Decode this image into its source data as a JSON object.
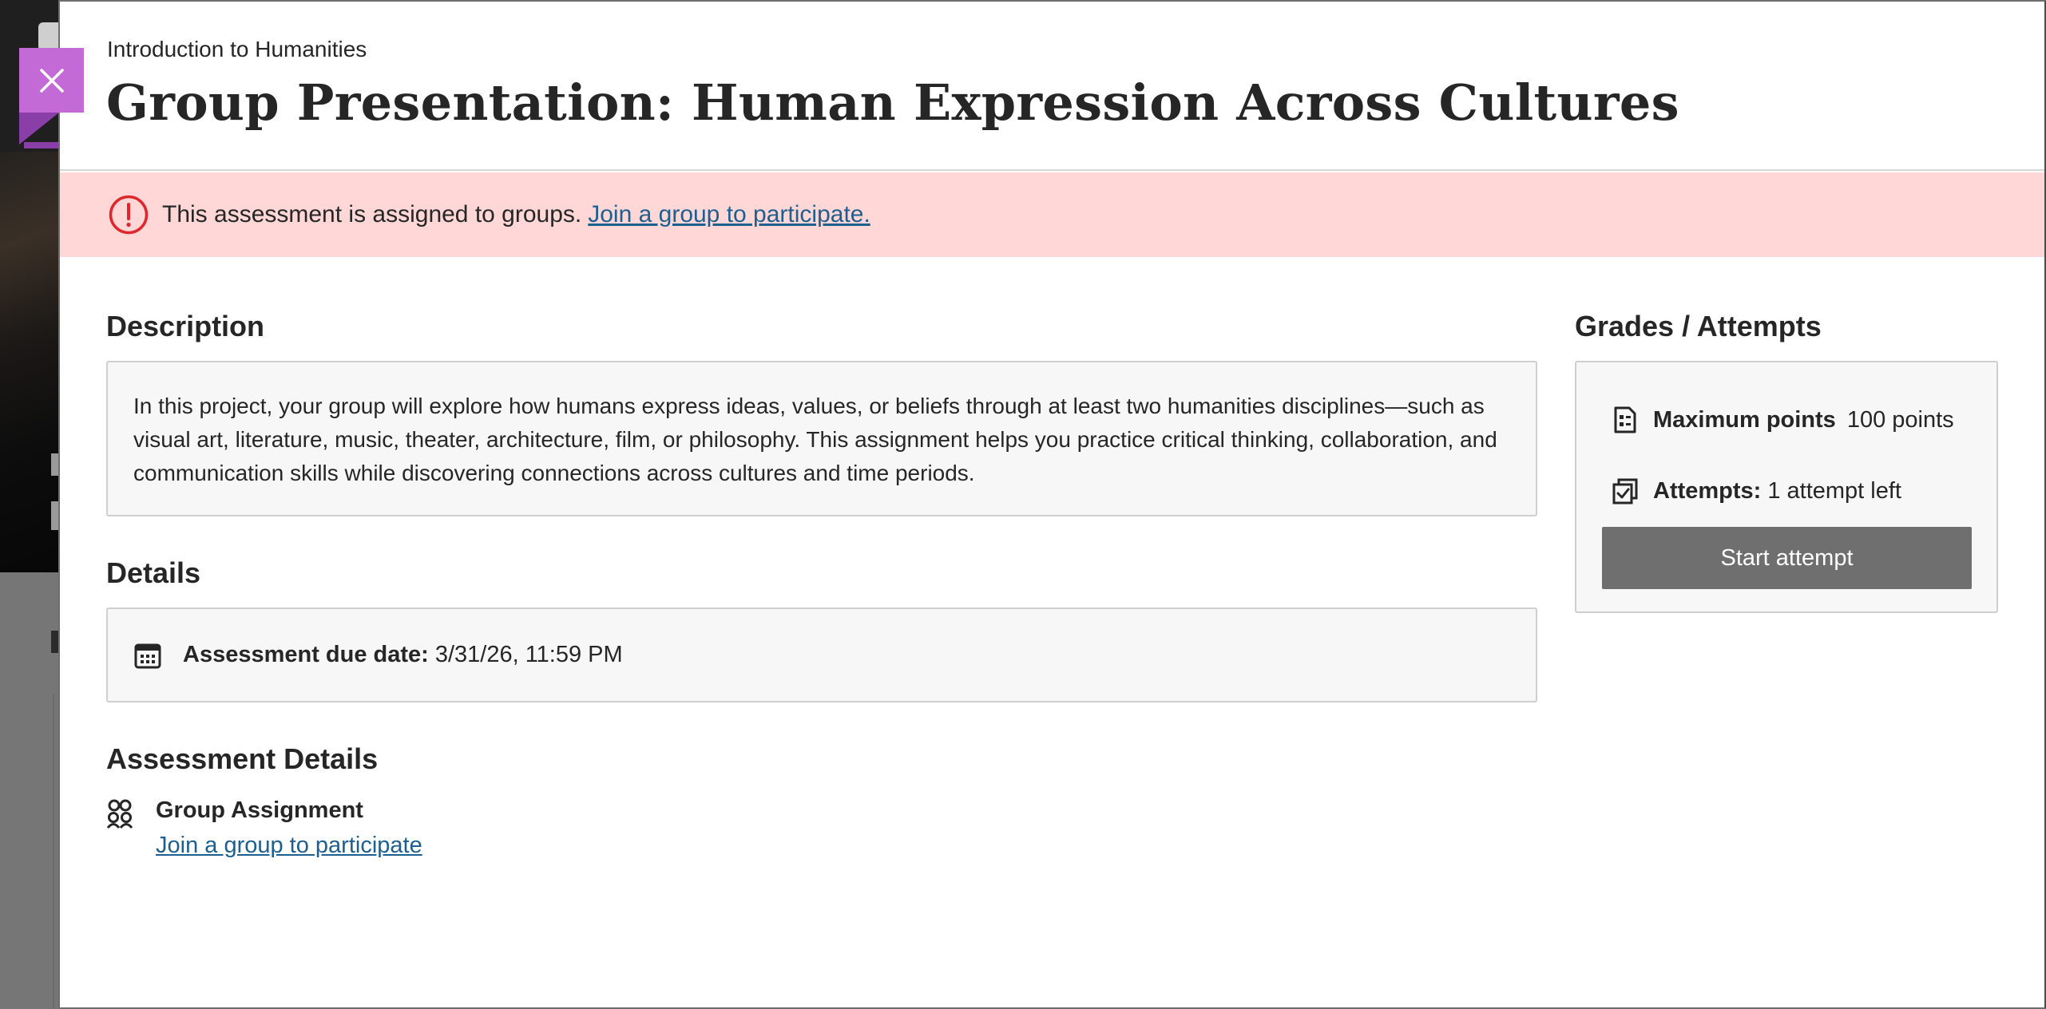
{
  "course": {
    "name": "Introduction to Humanities"
  },
  "page": {
    "title": "Group Presentation: Human Expression Across Cultures"
  },
  "close_button": {
    "icon": "close-icon"
  },
  "alert": {
    "icon": "exclamation-circle-icon",
    "text": "This assessment is assigned to groups.",
    "link": "Join a group to participate.",
    "background": "#ffd7d7"
  },
  "description": {
    "heading": "Description",
    "text": "In this project, your group will explore how humans express ideas, values, or beliefs through at least two humanities disciplines—such as visual art, literature, music, theater, architecture, film, or philosophy. This assignment helps you practice critical thinking, collaboration, and communication skills while discovering connections across cultures and time periods."
  },
  "details": {
    "heading": "Details",
    "due_label": "Assessment due date:",
    "due_value": "3/31/26, 11:59 PM",
    "icon": "calendar-icon"
  },
  "assessment_details": {
    "heading": "Assessment Details",
    "group_title": "Group Assignment",
    "group_link": "Join a group to participate",
    "icon": "group-icon"
  },
  "grades": {
    "heading": "Grades / Attempts",
    "max_points_label": "Maximum points",
    "max_points_value": "100 points",
    "attempts_label": "Attempts:",
    "attempts_value": "1 attempt left",
    "start_button": "Start attempt"
  },
  "colors": {
    "accent": "#c36ad6",
    "link": "#1d5f8f",
    "alert_icon": "#e0262d",
    "button_bg": "#6f6f6f"
  }
}
